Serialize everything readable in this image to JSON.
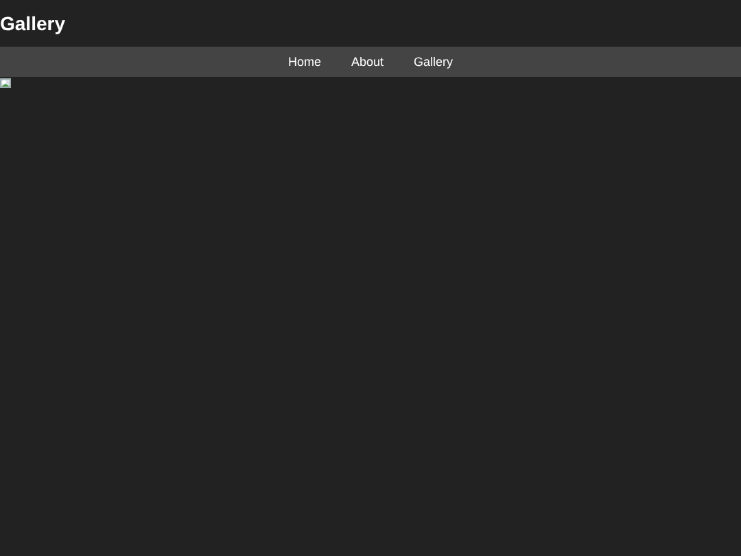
{
  "header": {
    "title": "Gallery"
  },
  "nav": {
    "links": [
      {
        "label": "Home"
      },
      {
        "label": "About"
      },
      {
        "label": "Gallery"
      }
    ]
  },
  "content": {
    "images": [
      {
        "kind": "broken-image"
      }
    ]
  }
}
